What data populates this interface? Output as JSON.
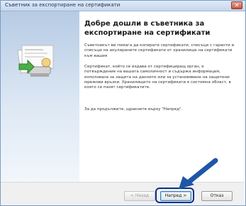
{
  "window": {
    "title": "Съветник за експортиране на сертификати",
    "close_glyph": "✕"
  },
  "wizard": {
    "heading": "Добре дошли в съветника за експортиране на сертификати",
    "paragraph1": "Съветникът ви помага да копирате сертификати, списъци с гаранти и списъци на анулираните сертификати от хранилище на сертификати към вашия",
    "paragraph2": "Сертификат, който се издава от сертифициращ орган, е потвърждение на вашата самоличност и съдържа информация, използвана за защита на данните или за установяване на защитени мрежови връзки. Хранилището на сертификати е системна област, в която се пазят сертификатите.",
    "paragraph3": "За да продължите, щракнете върху \"Напред\"."
  },
  "buttons": {
    "back": "< Назад",
    "next": "Напред >",
    "cancel": "Отказ"
  },
  "colors": {
    "highlight": "#0d2f8a",
    "arrow": "#1f56a8",
    "panel_top": "#b6cbe4"
  }
}
